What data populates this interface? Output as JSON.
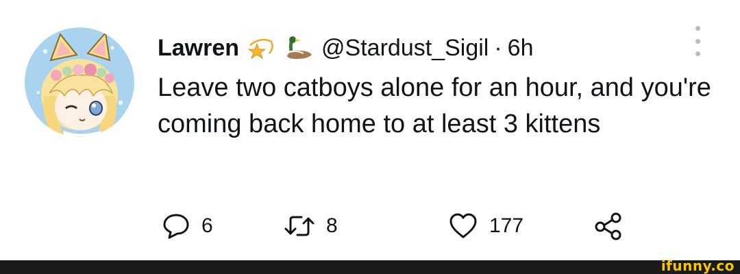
{
  "tweet": {
    "display_name": "Lawren",
    "badges": [
      "dizzy-star-emoji",
      "duck-emoji"
    ],
    "handle": "@Stardust_Sigil",
    "separator": "·",
    "time": "6h",
    "body": "Leave two catboys alone for an hour, and you're coming back home to at least 3 kittens",
    "actions": {
      "replies": "6",
      "retweets": "8",
      "likes": "177"
    }
  },
  "watermark": {
    "text": "ifunny.co"
  },
  "colors": {
    "text": "#0f1419",
    "icon": "#0f1419",
    "more_dots": "#b6bcc1",
    "footer_bar": "#1a1a1a",
    "watermark": "#f7c600"
  }
}
